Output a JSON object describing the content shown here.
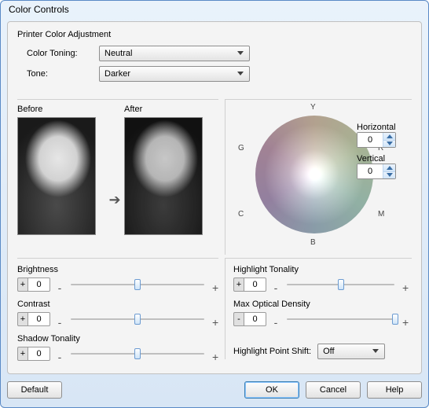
{
  "window": {
    "title": "Color Controls"
  },
  "section": {
    "heading": "Printer Color Adjustment"
  },
  "fields": {
    "color_toning_label": "Color Toning:",
    "color_toning_value": "Neutral",
    "tone_label": "Tone:",
    "tone_value": "Darker"
  },
  "preview": {
    "before_label": "Before",
    "after_label": "After"
  },
  "wheel": {
    "labels": {
      "y": "Y",
      "g": "G",
      "r": "R",
      "c": "C",
      "m": "M",
      "b": "B"
    }
  },
  "hv": {
    "horizontal_label": "Horizontal",
    "horizontal_value": "0",
    "vertical_label": "Vertical",
    "vertical_value": "0"
  },
  "sliders": {
    "brightness": {
      "label": "Brightness",
      "sign": "+",
      "value": "0",
      "pos": 50
    },
    "contrast": {
      "label": "Contrast",
      "sign": "+",
      "value": "0",
      "pos": 50
    },
    "shadow_tonality": {
      "label": "Shadow Tonality",
      "sign": "+",
      "value": "0",
      "pos": 50
    },
    "highlight_tonality": {
      "label": "Highlight Tonality",
      "sign": "+",
      "value": "0",
      "pos": 50
    },
    "max_optical_density": {
      "label": "Max Optical Density",
      "sign": "-",
      "value": "0",
      "pos": 98
    }
  },
  "hps": {
    "label": "Highlight Point Shift:",
    "value": "Off"
  },
  "buttons": {
    "default": "Default",
    "ok": "OK",
    "cancel": "Cancel",
    "help": "Help"
  }
}
